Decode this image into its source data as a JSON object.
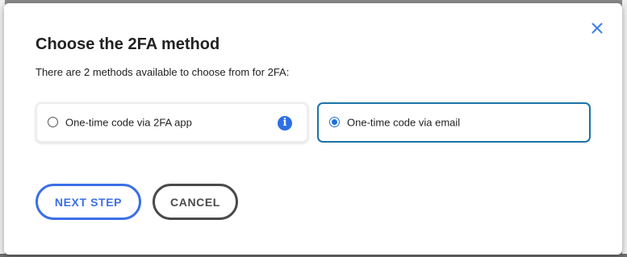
{
  "dialog": {
    "title": "Choose the 2FA method",
    "subtitle": "There are 2 methods available to choose from for 2FA:",
    "close_icon": "close-icon"
  },
  "options": [
    {
      "label": "One-time code via 2FA app",
      "selected": false,
      "icon": "info-icon",
      "icon_glyph": "i"
    },
    {
      "label": "One-time code via email",
      "selected": true
    }
  ],
  "buttons": {
    "next_label": "NEXT STEP",
    "cancel_label": "CANCEL"
  },
  "colors": {
    "accent": "#3b6fe8",
    "selected_border": "#1a73a8",
    "cancel": "#4a4a4a"
  }
}
